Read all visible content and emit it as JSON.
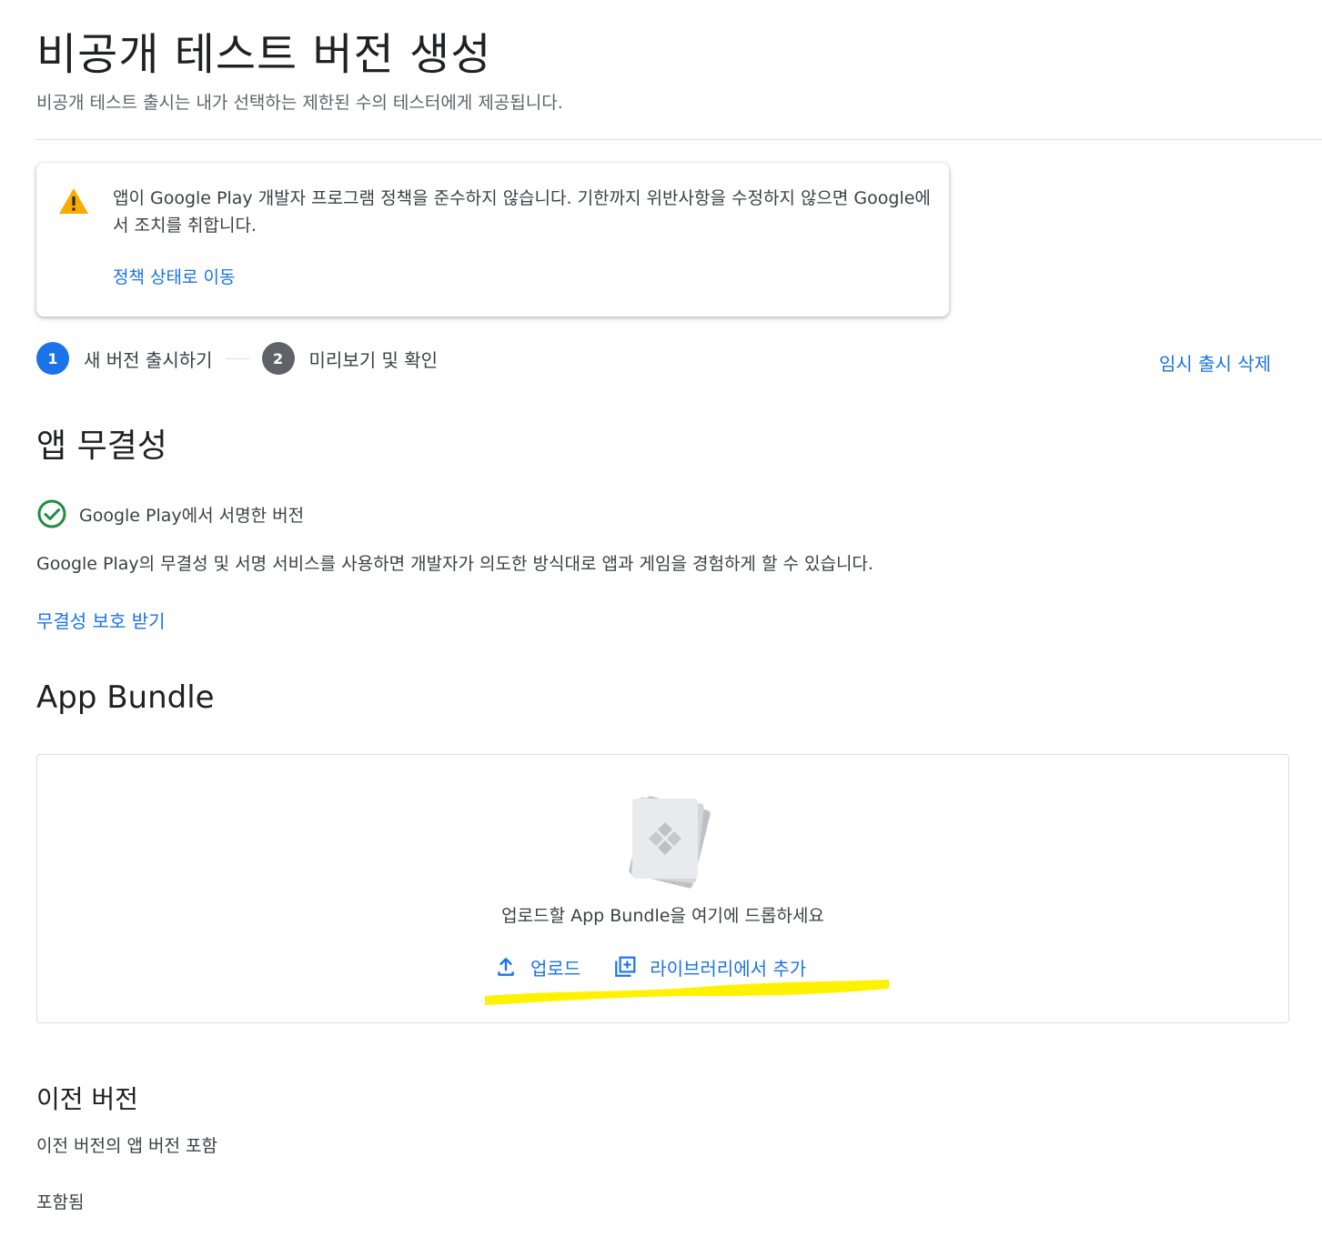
{
  "page": {
    "title": "비공개 테스트 버전 생성",
    "subtitle": "비공개 테스트 출시는 내가 선택하는 제한된 수의 테스터에게 제공됩니다."
  },
  "policy_warning": {
    "message": "앱이 Google Play 개발자 프로그램 정책을 준수하지 않습니다. 기한까지 위반사항을 수정하지 않으면 Google에서 조치를 취합니다.",
    "link": "정책 상태로 이동",
    "icon": "warning-icon"
  },
  "stepper": {
    "steps": [
      {
        "number": "1",
        "label": "새 버전 출시하기",
        "active": true
      },
      {
        "number": "2",
        "label": "미리보기 및 확인",
        "active": false
      }
    ],
    "discard_link": "임시 출시 삭제"
  },
  "integrity": {
    "heading": "앱 무결성",
    "signed_label": "Google Play에서 서명한 버전",
    "description": "Google Play의 무결성 및 서명 서비스를 사용하면 개발자가 의도한 방식대로 앱과 게임을 경험하게 할 수 있습니다.",
    "link": "무결성 보호 받기"
  },
  "app_bundle": {
    "heading": "App Bundle",
    "drop_text": "업로드할 App Bundle을 여기에 드롭하세요",
    "upload_label": "업로드",
    "library_label": "라이브러리에서 추가"
  },
  "previous_versions": {
    "heading": "이전 버전",
    "description": "이전 버전의 앱 버전 포함",
    "value": "포함됨"
  },
  "colors": {
    "primary": "#1a73e8",
    "warning": "#f9ab00",
    "success": "#1e8e3e",
    "highlight": "#fff200"
  }
}
